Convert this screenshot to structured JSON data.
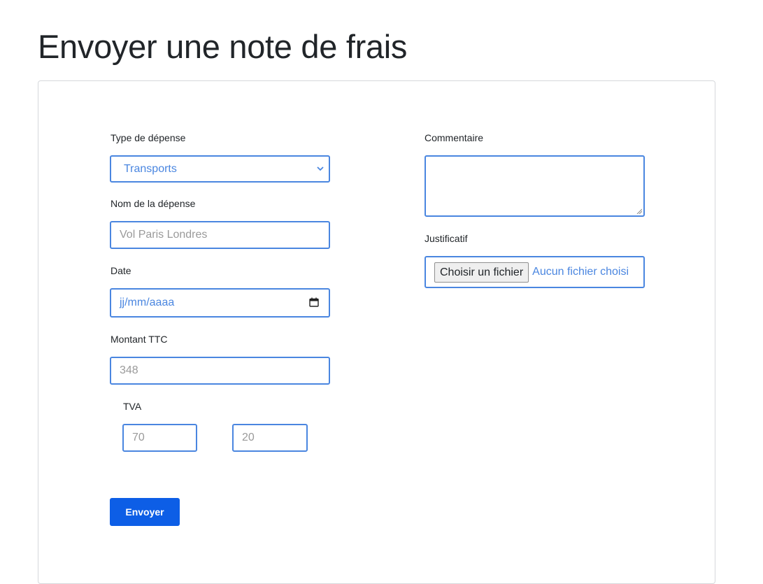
{
  "page": {
    "title": "Envoyer une note de frais"
  },
  "form": {
    "type_depense": {
      "label": "Type de dépense",
      "selected": "Transports"
    },
    "nom_depense": {
      "label": "Nom de la dépense",
      "placeholder": "Vol Paris Londres"
    },
    "date": {
      "label": "Date",
      "placeholder": "jj/mm/aaaa"
    },
    "montant_ttc": {
      "label": "Montant TTC",
      "placeholder": "348"
    },
    "tva": {
      "label": "TVA",
      "amount_placeholder": "70",
      "rate_placeholder": "20"
    },
    "commentaire": {
      "label": "Commentaire",
      "value": ""
    },
    "justificatif": {
      "label": "Justificatif",
      "button_label": "Choisir un fichier",
      "status": "Aucun fichier choisi"
    },
    "submit_label": "Envoyer"
  },
  "colors": {
    "accent": "#4a86e0",
    "submit_background": "#0d5ee6",
    "placeholder": "#9a9a9a"
  },
  "icons": {
    "select_indicator": "chevron-down-icon",
    "date_picker": "calendar-icon",
    "textarea_resize": "resize-grip-icon"
  }
}
